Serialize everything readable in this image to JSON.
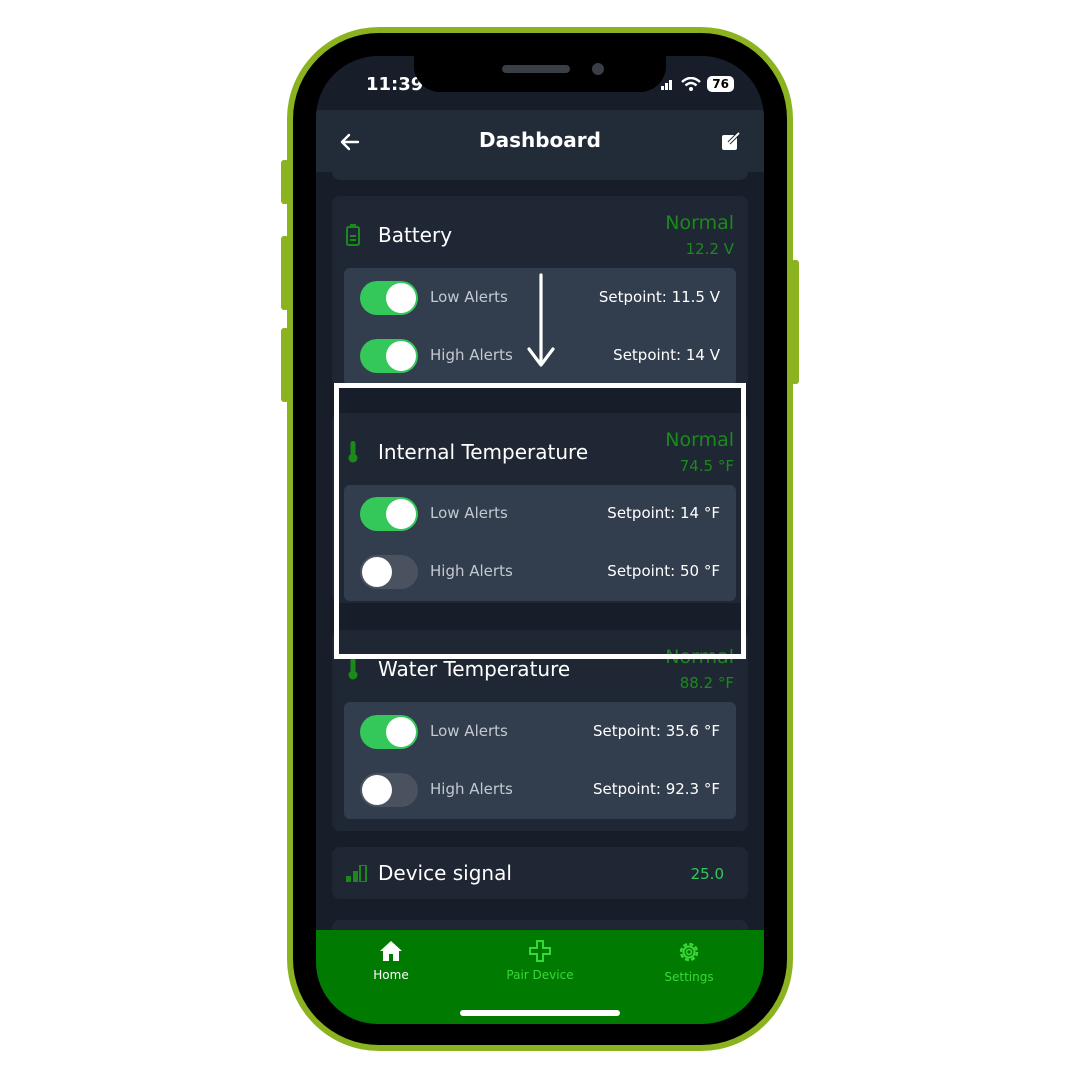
{
  "status_bar": {
    "time": "11:39",
    "battery": "76"
  },
  "header": {
    "title": "Dashboard"
  },
  "cards": [
    {
      "title": "Battery",
      "status": "Normal",
      "value": "12.2  V",
      "alerts": [
        {
          "label": "Low Alerts",
          "enabled": true,
          "setpoint": "Setpoint: 11.5 V"
        },
        {
          "label": "High Alerts",
          "enabled": true,
          "setpoint": "Setpoint: 14 V"
        }
      ]
    },
    {
      "title": "Internal Temperature",
      "status": "Normal",
      "value": "74.5  °F",
      "alerts": [
        {
          "label": "Low Alerts",
          "enabled": true,
          "setpoint": "Setpoint: 14 °F"
        },
        {
          "label": "High Alerts",
          "enabled": false,
          "setpoint": "Setpoint: 50 °F"
        }
      ]
    },
    {
      "title": "Water Temperature",
      "status": "Normal",
      "value": "88.2  °F",
      "alerts": [
        {
          "label": "Low Alerts",
          "enabled": true,
          "setpoint": "Setpoint: 35.6 °F"
        },
        {
          "label": "High Alerts",
          "enabled": false,
          "setpoint": "Setpoint: 92.3 °F"
        }
      ]
    }
  ],
  "signal": {
    "title": "Device signal",
    "value": "25.0"
  },
  "nav": [
    {
      "label": "Home",
      "icon": "home-icon"
    },
    {
      "label": "Pair Device",
      "icon": "plus-icon"
    },
    {
      "label": "Settings",
      "icon": "gear-icon"
    }
  ],
  "colors": {
    "frame": "#8bb31f",
    "nav_bg": "#007a00",
    "status_green": "#1a8a1a",
    "toggle_on": "#34c759"
  }
}
